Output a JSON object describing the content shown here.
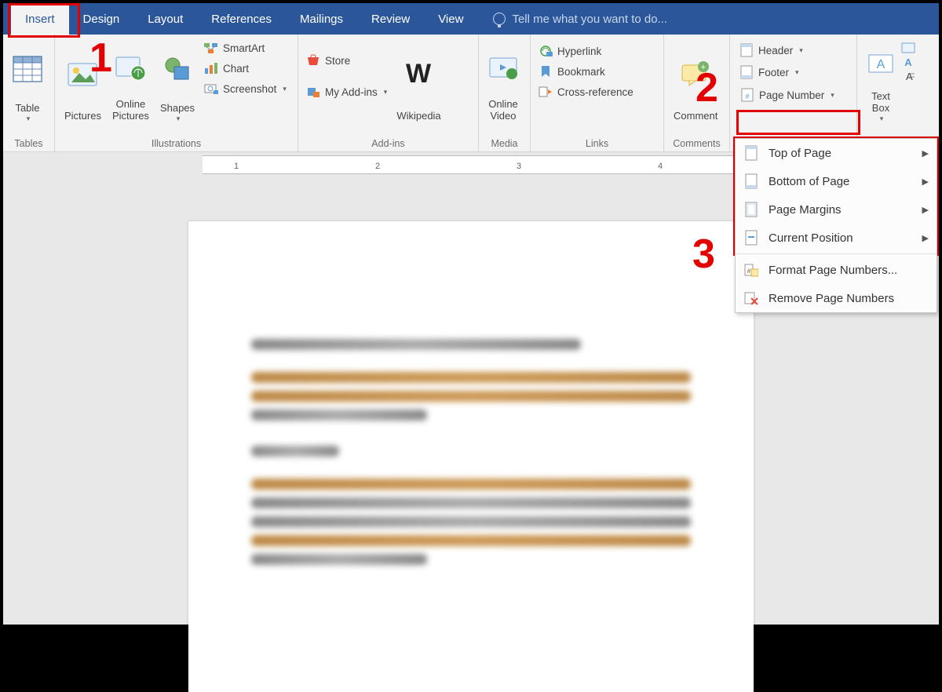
{
  "tabs": {
    "insert": "Insert",
    "design": "Design",
    "layout": "Layout",
    "references": "References",
    "mailings": "Mailings",
    "review": "Review",
    "view": "View",
    "tellme": "Tell me what you want to do..."
  },
  "ribbon": {
    "tables": {
      "label": "Tables",
      "table": "Table"
    },
    "illustrations": {
      "label": "Illustrations",
      "pictures": "Pictures",
      "online_pictures": "Online\nPictures",
      "shapes": "Shapes",
      "smartart": "SmartArt",
      "chart": "Chart",
      "screenshot": "Screenshot"
    },
    "addins": {
      "label": "Add-ins",
      "store": "Store",
      "myaddins": "My Add-ins",
      "wikipedia": "Wikipedia"
    },
    "media": {
      "label": "Media",
      "online_video": "Online\nVideo"
    },
    "links": {
      "label": "Links",
      "hyperlink": "Hyperlink",
      "bookmark": "Bookmark",
      "crossref": "Cross-reference"
    },
    "comments": {
      "label": "Comments",
      "comment": "Comment"
    },
    "headerfooter": {
      "header": "Header",
      "footer": "Footer",
      "page_number": "Page Number"
    },
    "text": {
      "textbox": "Text\nBox"
    }
  },
  "dropdown": {
    "top": "Top of Page",
    "bottom": "Bottom of Page",
    "margins": "Page Margins",
    "current": "Current Position",
    "format": "Format Page Numbers...",
    "remove": "Remove Page Numbers"
  },
  "callouts": {
    "n1": "1",
    "n2": "2",
    "n3": "3"
  },
  "ruler_marks": [
    "1",
    "2",
    "3",
    "4"
  ],
  "colors": {
    "accent": "#2b579a",
    "callout": "#e30000"
  }
}
